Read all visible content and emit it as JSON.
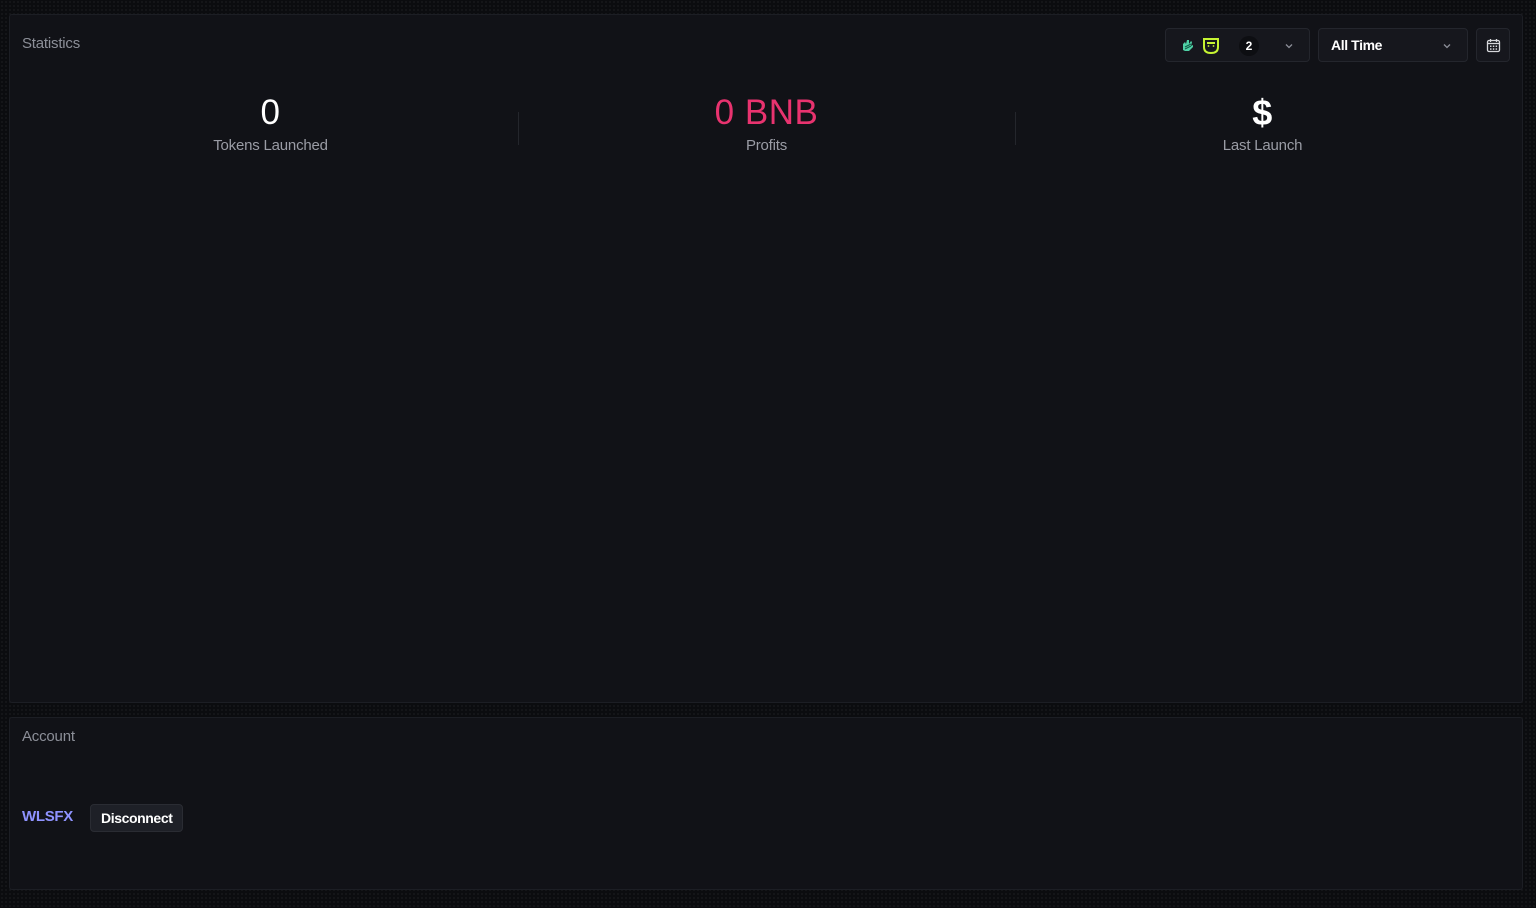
{
  "statistics": {
    "title": "Statistics",
    "chain_selector": {
      "icons": [
        "blockchain-hand-icon",
        "smiley-chain-icon"
      ],
      "count": "2"
    },
    "time_range": {
      "selected": "All Time"
    },
    "stats": [
      {
        "value": "0",
        "label": "Tokens Launched"
      },
      {
        "value": "0 BNB",
        "label": "Profits",
        "color": "#e8336f"
      },
      {
        "value": "$",
        "label": "Last Launch"
      }
    ]
  },
  "account": {
    "title": "Account",
    "name": "WLSFX",
    "disconnect_label": "Disconnect"
  },
  "colors": {
    "background": "#0b0c0f",
    "panel": "#111217",
    "accent_pink": "#e8336f",
    "account_name": "#8f93ff",
    "chain_icon_1": "#4fd1a5",
    "chain_icon_2": "#c6f432"
  }
}
